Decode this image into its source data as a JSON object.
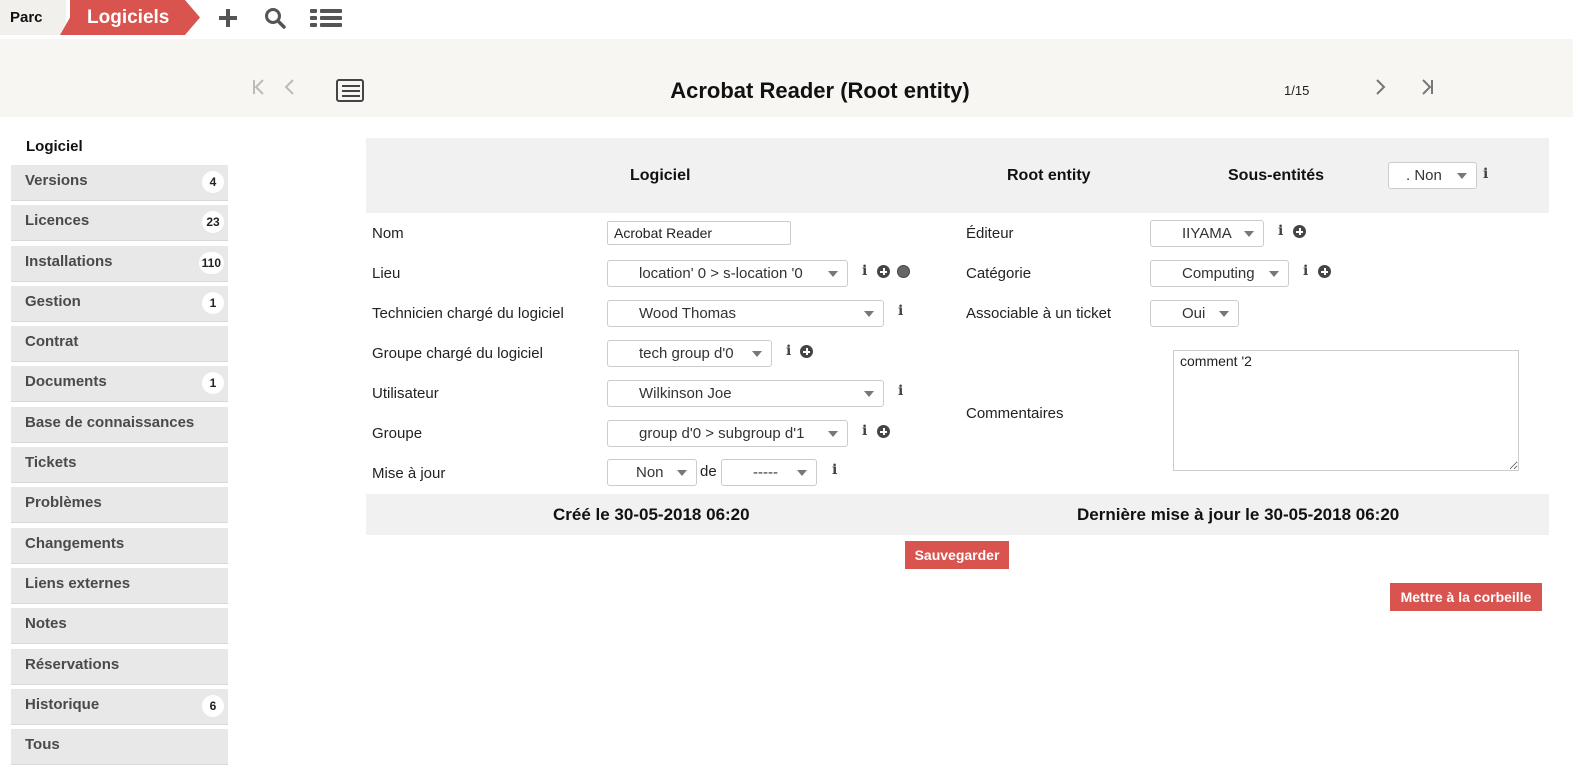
{
  "topbar": {
    "breadcrumb_parent": "Parc",
    "breadcrumb_current": "Logiciels",
    "icons": [
      "plus-icon",
      "search-icon",
      "list-icon"
    ]
  },
  "header": {
    "title": "Acrobat Reader (Root entity)",
    "pager": "1/15"
  },
  "sidebar": {
    "heading": "Logiciel",
    "items": [
      {
        "label": "Versions",
        "badge": "4"
      },
      {
        "label": "Licences",
        "badge": "23"
      },
      {
        "label": "Installations",
        "badge": "110"
      },
      {
        "label": "Gestion",
        "badge": "1"
      },
      {
        "label": "Contrat",
        "badge": ""
      },
      {
        "label": "Documents",
        "badge": "1"
      },
      {
        "label": "Base de connaissances",
        "badge": ""
      },
      {
        "label": "Tickets",
        "badge": ""
      },
      {
        "label": "Problèmes",
        "badge": ""
      },
      {
        "label": "Changements",
        "badge": ""
      },
      {
        "label": "Liens externes",
        "badge": ""
      },
      {
        "label": "Notes",
        "badge": ""
      },
      {
        "label": "Réservations",
        "badge": ""
      },
      {
        "label": "Historique",
        "badge": "6"
      },
      {
        "label": "Tous",
        "badge": ""
      }
    ]
  },
  "form": {
    "header": {
      "section": "Logiciel",
      "entity": "Root entity",
      "subentities_label": "Sous-entités",
      "subentities_value": ". Non"
    },
    "left": {
      "name_label": "Nom",
      "name_value": "Acrobat Reader",
      "location_label": "Lieu",
      "location_value": "location' 0 > s-location '0",
      "tech_label": "Technicien chargé du logiciel",
      "tech_value": "Wood Thomas",
      "tech_group_label": "Groupe chargé du logiciel",
      "tech_group_value": "tech group d'0",
      "user_label": "Utilisateur",
      "user_value": "Wilkinson Joe",
      "group_label": "Groupe",
      "group_value": "group d'0 > subgroup d'1",
      "update_label": "Mise à jour",
      "update_value": "Non",
      "update_of": "de",
      "update_from_value": "-----"
    },
    "right": {
      "editor_label": "Éditeur",
      "editor_value": "IIYAMA",
      "category_label": "Catégorie",
      "category_value": "Computing",
      "ticket_label": "Associable à un ticket",
      "ticket_value": "Oui",
      "comments_label": "Commentaires",
      "comments_value": "comment '2"
    },
    "footer": {
      "created": "Créé le 30-05-2018 06:20",
      "updated": "Dernière mise à jour le 30-05-2018 06:20"
    },
    "save_button": "Sauvegarder",
    "trash_button": "Mettre à la corbeille"
  },
  "colors": {
    "accent": "#d9534f",
    "band": "#f7f6f2",
    "panel": "#f1f1f1",
    "sidebar_item": "#e8e8e8"
  }
}
